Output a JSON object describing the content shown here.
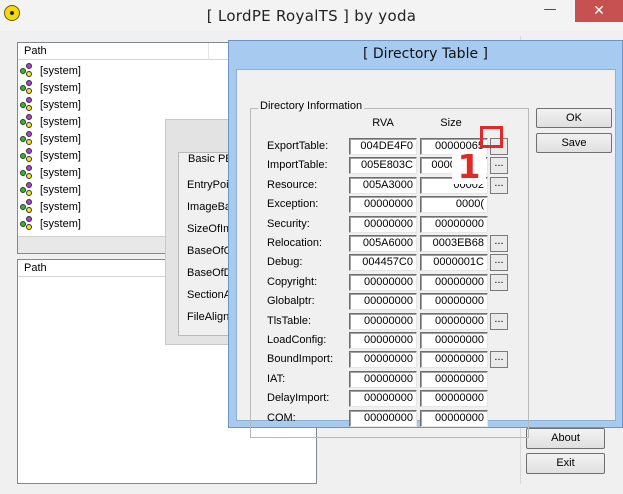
{
  "main_window": {
    "title": "[ LordPE RoyalTS ] by yoda",
    "minimize_glyph": "—",
    "close_glyph": "✕",
    "app_icon": "radiation-icon"
  },
  "process_list": {
    "header": "Path",
    "rows": [
      "[system]",
      "[system]",
      "[system]",
      "[system]",
      "[system]",
      "[system]",
      "[system]",
      "[system]",
      "[system]",
      "[system]"
    ]
  },
  "module_list": {
    "header": "Path"
  },
  "basic_pe": {
    "legend": "Basic PE",
    "labels": [
      "EntryPoi",
      "ImageBa",
      "SizeOfIm",
      "BaseOfC",
      "BaseOfD",
      "SectionA",
      "FileAlign"
    ]
  },
  "buttons": {
    "about": "About",
    "exit": "Exit"
  },
  "directory_table": {
    "title": "[ Directory Table ]",
    "group_label": "Directory Information",
    "col_rva": "RVA",
    "col_size": "Size",
    "ok": "OK",
    "save": "Save",
    "dots_label": "...",
    "rows": [
      {
        "name": "ExportTable:",
        "rva": "004DE4F0",
        "size": "00000065",
        "has_button": true
      },
      {
        "name": "ImportTable:",
        "rva": "005E803C",
        "size": "000001CC",
        "has_button": true
      },
      {
        "name": "Resource:",
        "rva": "005A3000",
        "size": "00002",
        "has_button": true
      },
      {
        "name": "Exception:",
        "rva": "00000000",
        "size": "0000(",
        "has_button": false
      },
      {
        "name": "Security:",
        "rva": "00000000",
        "size": "00000000",
        "has_button": false
      },
      {
        "name": "Relocation:",
        "rva": "005A6000",
        "size": "0003EB68",
        "has_button": true
      },
      {
        "name": "Debug:",
        "rva": "004457C0",
        "size": "0000001C",
        "has_button": true
      },
      {
        "name": "Copyright:",
        "rva": "00000000",
        "size": "00000000",
        "has_button": true
      },
      {
        "name": "Globalptr:",
        "rva": "00000000",
        "size": "00000000",
        "has_button": false
      },
      {
        "name": "TlsTable:",
        "rva": "00000000",
        "size": "00000000",
        "has_button": true
      },
      {
        "name": "LoadConfig:",
        "rva": "00000000",
        "size": "00000000",
        "has_button": false
      },
      {
        "name": "BoundImport:",
        "rva": "00000000",
        "size": "00000000",
        "has_button": true
      },
      {
        "name": "IAT:",
        "rva": "00000000",
        "size": "00000000",
        "has_button": false
      },
      {
        "name": "DelayImport:",
        "rva": "00000000",
        "size": "00000000",
        "has_button": false
      },
      {
        "name": "COM:",
        "rva": "00000000",
        "size": "00000000",
        "has_button": false
      }
    ]
  },
  "annotation": {
    "number": "1",
    "color": "#e02a2a"
  }
}
